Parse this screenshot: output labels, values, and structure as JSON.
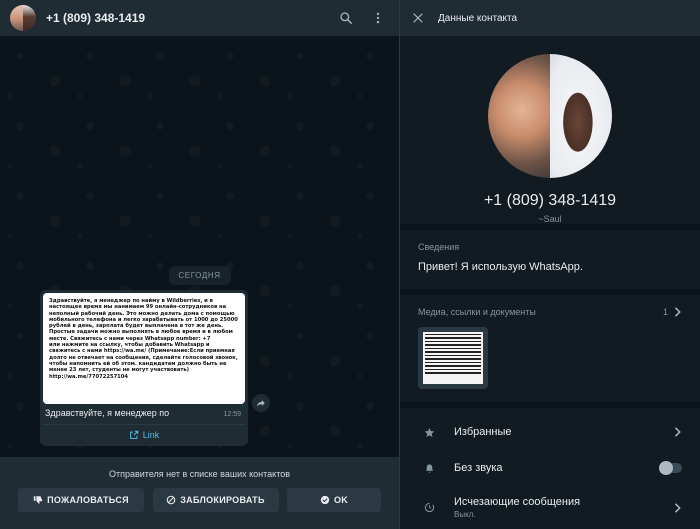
{
  "chat": {
    "contact_name": "+1 (809) 348-1419",
    "date_label": "СЕГОДНЯ",
    "message": {
      "image_text": "Здравствуйте, я менеджер по найму в Wildberries, и в настоящее время мы нанимаем 99 онлайн-сотрудников на неполный рабочий день. Это можно делать дома с помощью мобильного телефона и легко зарабатывать от 1000 до 25000 рублей в день, зарплата будет выплачена в тот же день.\nПростые задачи можно выполнять в любое время и в любом месте. Свяжитесь с нами через Whatsapp number: +7\nили нажмите на ссылку, чтобы добавить Whatsapp и свяжитесь с нами https://wa.me/ (Примечание:Если приемная долго не отвечает на сообщения, сделайте голосовой звонок, чтобы напомнить ей об этом. кандидатам должно быть не менее 23 лет, студенты не могут участвовать)\nhttp://wa.me/77072257104",
      "text": "Здравствуйте, я менеджер по",
      "time": "12:59",
      "link_label": "Link"
    },
    "spam_bar": {
      "notice": "Отправителя нет в списке ваших контактов",
      "report_label": "ПОЖАЛОВАТЬСЯ",
      "block_label": "ЗАБЛОКИРОВАТЬ",
      "ok_label": "OK"
    }
  },
  "contact_panel": {
    "title": "Данные контакта",
    "phone": "+1 (809) 348-1419",
    "nickname": "~Saul",
    "about_label": "Сведения",
    "about_value": "Привет! Я использую WhatsApp.",
    "media_label": "Медиа, ссылки и документы",
    "media_count": "1",
    "options": {
      "starred": "Избранные",
      "mute": "Без звука",
      "disappearing": "Исчезающие сообщения",
      "disappearing_sub": "Выкл."
    }
  },
  "colors": {
    "panel_bg": "#111b21",
    "header_bg": "#202c33",
    "link_blue": "#53bdeb"
  },
  "icons": [
    "search-icon",
    "menu-dots-icon",
    "close-icon",
    "link-icon",
    "forward-icon",
    "thumbs-down-icon",
    "block-icon",
    "check-circle-icon",
    "chevron-right-icon",
    "star-icon",
    "bell-icon",
    "timer-icon"
  ]
}
